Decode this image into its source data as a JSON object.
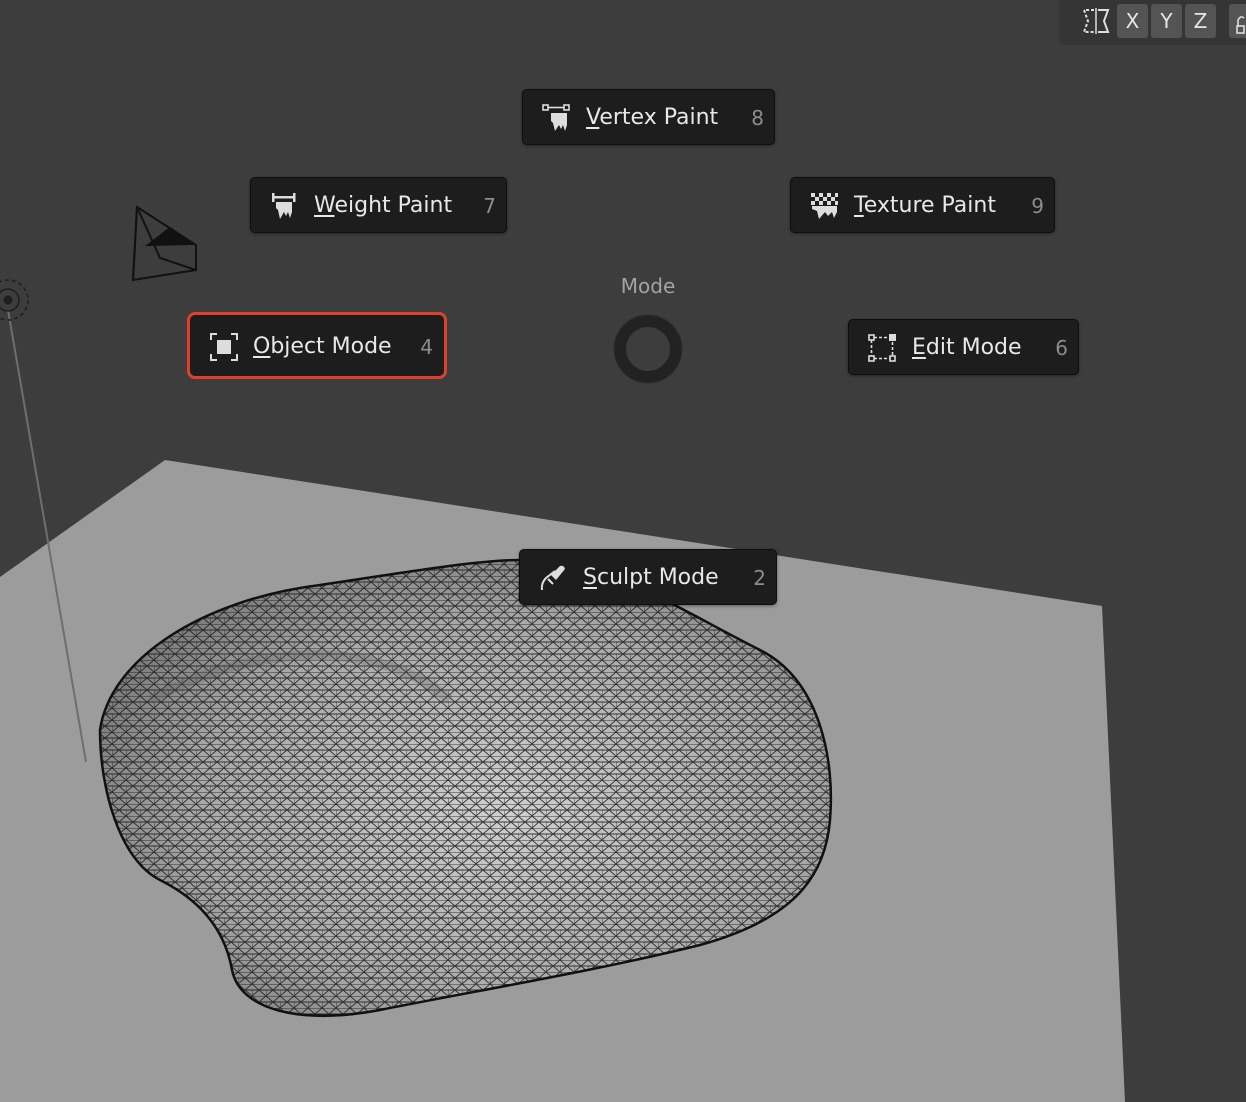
{
  "viewport": {
    "header": {
      "axis_buttons": [
        "X",
        "Y",
        "Z"
      ],
      "icons": [
        "mirror-icon",
        "lock-icon"
      ]
    }
  },
  "pie_menu": {
    "title": "Mode",
    "items": [
      {
        "label_underline": "V",
        "label_rest": "ertex Paint",
        "shortcut": "8",
        "icon": "vertex-paint-icon"
      },
      {
        "label_underline": "W",
        "label_rest": "eight Paint",
        "shortcut": "7",
        "icon": "weight-paint-icon"
      },
      {
        "label_underline": "T",
        "label_rest": "exture Paint",
        "shortcut": "9",
        "icon": "texture-paint-icon"
      },
      {
        "label_underline": "O",
        "label_rest": "bject Mode",
        "shortcut": "4",
        "icon": "object-mode-icon",
        "active": true
      },
      {
        "label_underline": "E",
        "label_rest": "dit Mode",
        "shortcut": "6",
        "icon": "edit-mode-icon"
      },
      {
        "label_underline": "S",
        "label_rest": "culpt Mode",
        "shortcut": "2",
        "icon": "sculpt-mode-icon"
      }
    ]
  },
  "colors": {
    "background": "#3d3d3d",
    "item_bg": "#1d1d1d",
    "highlight": "#e0402a",
    "floor": "#9a9a9a"
  }
}
